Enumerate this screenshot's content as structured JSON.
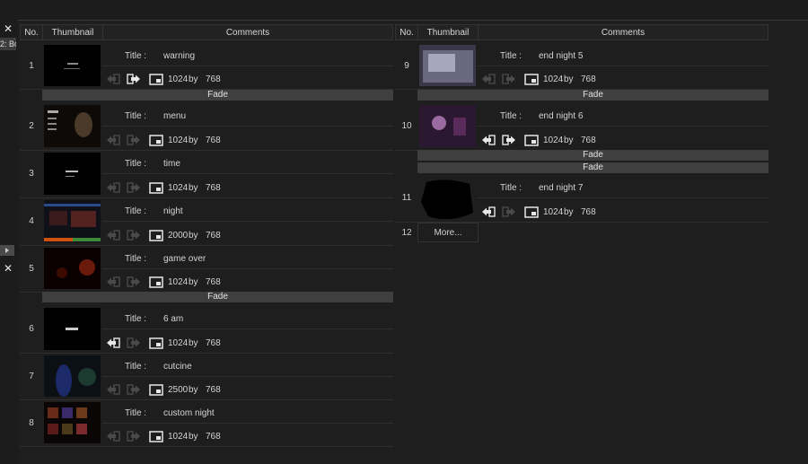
{
  "window": {
    "close_symbol": "✕",
    "side_label": "2: Bo"
  },
  "columns": {
    "no": "No.",
    "thumbnail": "Thumbnail",
    "comments": "Comments"
  },
  "fade_label": "Fade",
  "by_word": "by",
  "title_prefix": "Title : ",
  "frames": [
    {
      "no": "1",
      "title": "warning",
      "width": "1024",
      "height": "768",
      "in_active": false,
      "out_active": true
    },
    {
      "no": "2",
      "title": "menu",
      "width": "1024",
      "height": "768",
      "in_active": false,
      "out_active": false
    },
    {
      "no": "3",
      "title": "time",
      "width": "1024",
      "height": "768",
      "in_active": false,
      "out_active": false
    },
    {
      "no": "4",
      "title": "night",
      "width": "2000",
      "height": "768",
      "in_active": false,
      "out_active": false
    },
    {
      "no": "5",
      "title": "game over",
      "width": "1024",
      "height": "768",
      "in_active": false,
      "out_active": false
    },
    {
      "no": "6",
      "title": "6 am",
      "width": "1024",
      "height": "768",
      "in_active": true,
      "out_active": false
    },
    {
      "no": "7",
      "title": "cutcine",
      "width": "2500",
      "height": "768",
      "in_active": false,
      "out_active": false
    },
    {
      "no": "8",
      "title": "custom night",
      "width": "1024",
      "height": "768",
      "in_active": false,
      "out_active": false
    },
    {
      "no": "9",
      "title": "end night 5",
      "width": "1024",
      "height": "768",
      "in_active": false,
      "out_active": false
    },
    {
      "no": "10",
      "title": "end night 6",
      "width": "1024",
      "height": "768",
      "in_active": true,
      "out_active": true
    },
    {
      "no": "11",
      "title": "end night 7",
      "width": "1024",
      "height": "768",
      "in_active": true,
      "out_active": false
    }
  ],
  "more": {
    "no": "12",
    "label": "More..."
  },
  "colors": {
    "background": "#1e1e1e",
    "fade_bar": "#3f3f3f",
    "icon_active": "#e8e8e8",
    "icon_inactive": "#4a4a4a"
  }
}
